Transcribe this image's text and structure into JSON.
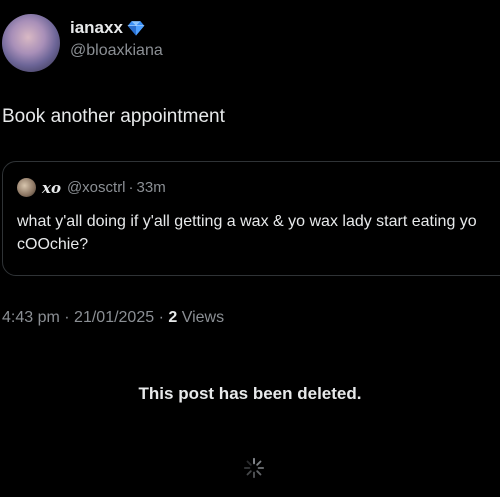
{
  "author": {
    "display_name": "ianaxx",
    "handle": "@bloaxkiana",
    "verified_icon": "diamond-verified-icon",
    "verified_color": "#3a8ff5"
  },
  "post": {
    "text": "Book another appointment",
    "time": "4:43 pm",
    "date": "21/01/2025",
    "views_count": "2",
    "views_label": "Views",
    "separator": "·"
  },
  "quote": {
    "display_name": "xo",
    "handle": "@xosctrl",
    "time": "33m",
    "separator": "·",
    "text": "what y'all doing if y'all getting a wax & yo wax lady start eating yo cOOchie?"
  },
  "deleted_notice": "This post has been deleted.",
  "colors": {
    "background": "#000000",
    "text_primary": "#e7e9ea",
    "text_secondary": "#8b8f94",
    "border": "#2f3336"
  }
}
